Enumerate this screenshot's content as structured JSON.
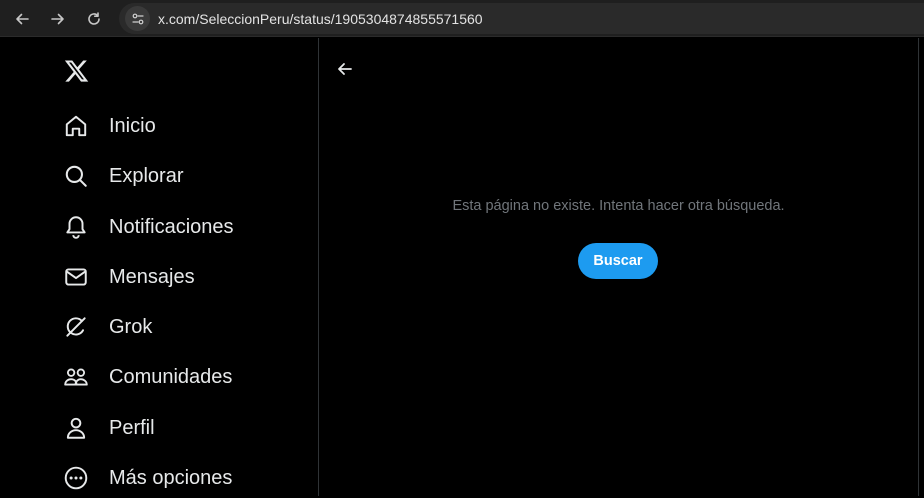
{
  "browser": {
    "url": "x.com/SeleccionPeru/status/1905304874855571560",
    "back_icon": "arrow-left-icon",
    "forward_icon": "arrow-right-icon",
    "reload_icon": "reload-icon",
    "site_info_icon": "tune-icon"
  },
  "sidebar": {
    "logo_icon": "x-logo-icon",
    "items": [
      {
        "label": "Inicio",
        "icon": "home-icon"
      },
      {
        "label": "Explorar",
        "icon": "search-icon"
      },
      {
        "label": "Notificaciones",
        "icon": "bell-icon"
      },
      {
        "label": "Mensajes",
        "icon": "envelope-icon"
      },
      {
        "label": "Grok",
        "icon": "grok-icon"
      },
      {
        "label": "Comunidades",
        "icon": "communities-icon"
      },
      {
        "label": "Perfil",
        "icon": "person-icon"
      },
      {
        "label": "Más opciones",
        "icon": "more-circle-icon"
      }
    ]
  },
  "main": {
    "back_icon": "arrow-left-icon",
    "message": "Esta página no existe. Intenta hacer otra búsqueda.",
    "search_button": "Buscar"
  },
  "colors": {
    "background": "#000000",
    "text": "#e7e9ea",
    "muted": "#71767b",
    "accent": "#1d9bf0"
  }
}
